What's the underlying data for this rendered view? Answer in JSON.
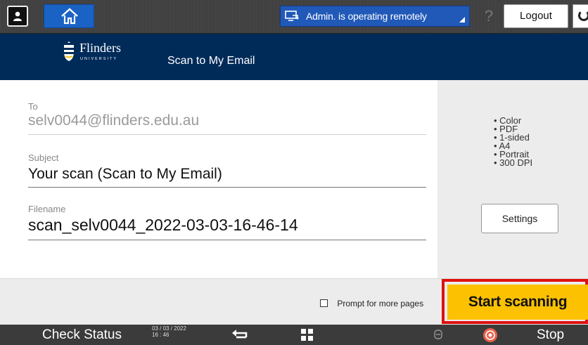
{
  "topbar": {
    "remote_status": "Admin. is operating remotely",
    "help_label": "?",
    "logout_label": "Logout"
  },
  "header": {
    "brand": "Flinders",
    "brand_sub": "UNIVERSITY",
    "title": "Scan to My Email"
  },
  "form": {
    "to_label": "To",
    "to_value": "selv0044@flinders.edu.au",
    "subject_label": "Subject",
    "subject_value": "Your scan (Scan to My Email)",
    "filename_label": "Filename",
    "filename_value": "scan_selv0044_2022-03-03-16-46-14"
  },
  "settings": {
    "options": [
      "Color",
      "PDF",
      "1-sided",
      "A4",
      "Portrait",
      "300 DPI"
    ],
    "button_label": "Settings"
  },
  "actions": {
    "prompt_label": "Prompt for more pages",
    "prompt_checked": false,
    "start_label": "Start scanning"
  },
  "bottombar": {
    "check_status_label": "Check Status",
    "date": "03 / 03 / 2022",
    "time": "16 : 46",
    "stop_label": "Stop"
  },
  "icons": [
    "user-icon",
    "home-icon",
    "remote-desktop-icon",
    "help-icon",
    "power-icon",
    "back-icon",
    "apps-grid-icon",
    "energy-saver-icon",
    "stop-icon"
  ],
  "colors": {
    "home_blue": "#1a62c4",
    "header_navy": "#002b59",
    "start_yellow": "#fcc100",
    "highlight_red": "#e01010"
  }
}
